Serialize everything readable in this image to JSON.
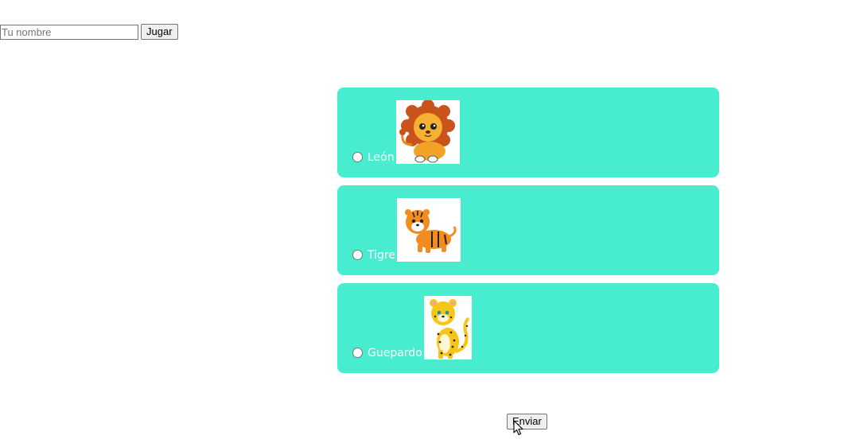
{
  "header": {
    "name_placeholder": "Tu nombre",
    "name_value": "",
    "play_label": "Jugar"
  },
  "options": [
    {
      "label": "León",
      "icon": "lion-icon",
      "selected": false
    },
    {
      "label": "Tigre",
      "icon": "tiger-icon",
      "selected": false
    },
    {
      "label": "Guepardo",
      "icon": "cheetah-icon",
      "selected": false
    }
  ],
  "submit_label": "Enviar",
  "colors": {
    "card_background": "#48ecce",
    "card_text": "#ffffff"
  }
}
